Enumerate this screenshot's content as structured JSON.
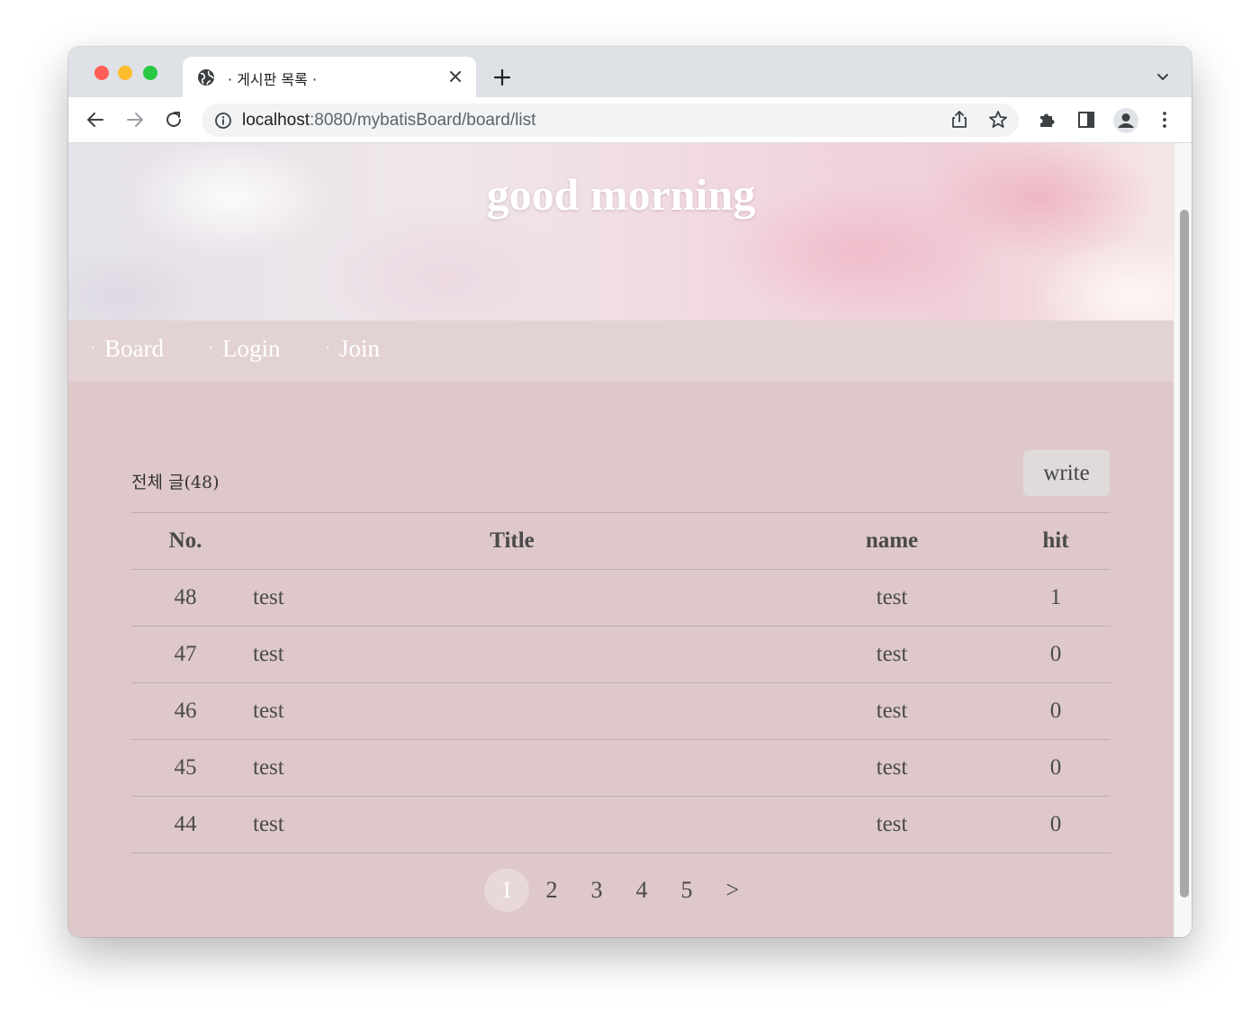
{
  "browser": {
    "tab_title": "· 게시판 목록 ·",
    "url_host": "localhost",
    "url_path": ":8080/mybatisBoard/board/list"
  },
  "hero": {
    "title": "good morning"
  },
  "nav": [
    {
      "bullet": "·",
      "label": "Board"
    },
    {
      "bullet": "·",
      "label": "Login"
    },
    {
      "bullet": "·",
      "label": "Join"
    }
  ],
  "board": {
    "summary": "전체 글(48)",
    "write_label": "write",
    "headers": {
      "no": "No.",
      "title": "Title",
      "name": "name",
      "hit": "hit"
    },
    "rows": [
      {
        "no": "48",
        "title": "test",
        "name": "test",
        "hit": "1"
      },
      {
        "no": "47",
        "title": "test",
        "name": "test",
        "hit": "0"
      },
      {
        "no": "46",
        "title": "test",
        "name": "test",
        "hit": "0"
      },
      {
        "no": "45",
        "title": "test",
        "name": "test",
        "hit": "0"
      },
      {
        "no": "44",
        "title": "test",
        "name": "test",
        "hit": "0"
      }
    ]
  },
  "pagination": {
    "pages": [
      "1",
      "2",
      "3",
      "4",
      "5"
    ],
    "current": "1",
    "next": ">"
  },
  "icons": {
    "tab": "globe-icon",
    "close": "close-icon",
    "new_tab": "plus-icon",
    "back": "back-arrow-icon",
    "forward": "forward-arrow-icon",
    "reload": "reload-icon",
    "info": "info-icon",
    "share": "share-icon",
    "bookmark": "star-icon",
    "extensions": "puzzle-icon",
    "side_panel": "side-panel-icon",
    "profile": "profile-icon",
    "menu": "kebab-menu-icon"
  }
}
